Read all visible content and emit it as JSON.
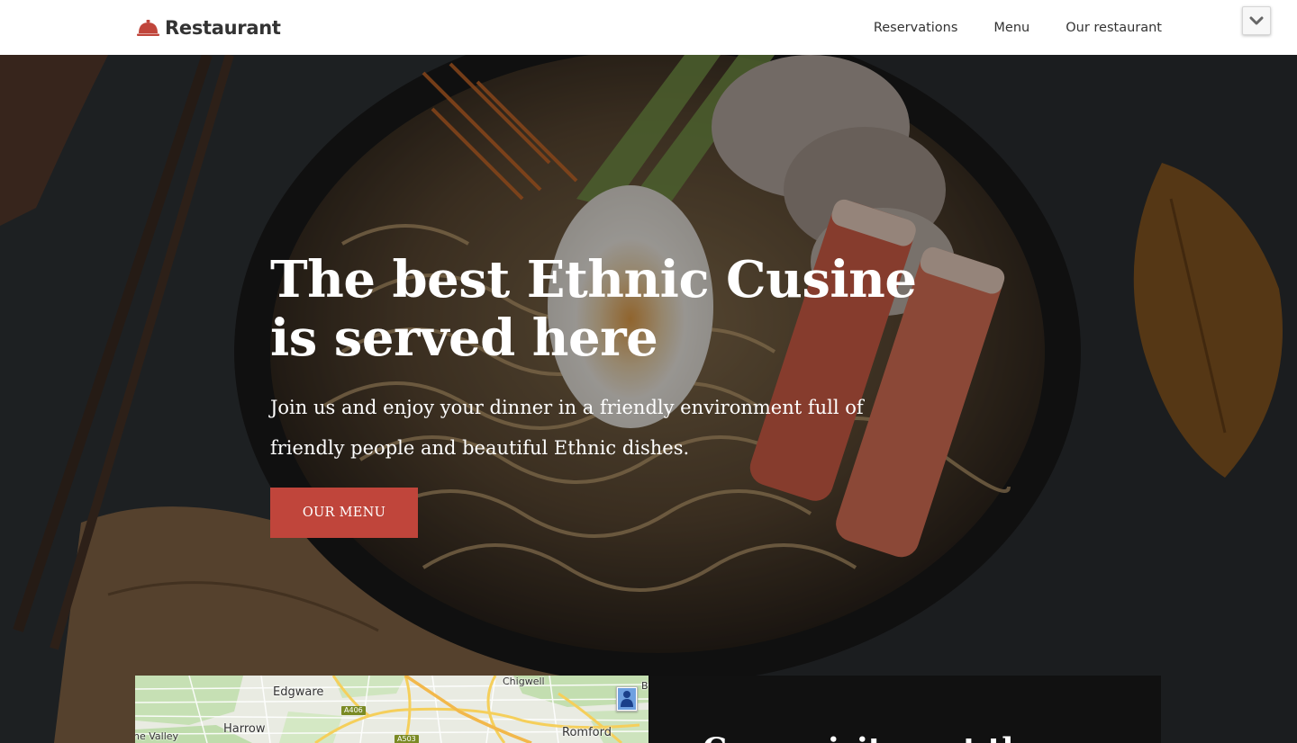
{
  "header": {
    "brand": "Restaurant",
    "brand_icon": "food-cloche-icon",
    "brand_color": "#c0453b",
    "nav": [
      "Reservations",
      "Menu",
      "Our restaurant"
    ],
    "toggle_icon": "chevron-down-icon"
  },
  "hero": {
    "title_line1": "The best Ethnic Cusine",
    "title_line2": "is served here",
    "subtitle": "Join us and enjoy your dinner in a friendly environment full of friendly people and beautiful Ethnic dishes.",
    "button_label": "OUR MENU",
    "button_color": "#c0453b"
  },
  "map": {
    "labels": {
      "edgware": "Edgware",
      "chigwell": "Chigwell",
      "harrow": "Harrow",
      "romford": "Romford",
      "valley": "ne Valley",
      "edge_b": "B"
    },
    "roads": {
      "a406": "A406",
      "a503": "A503"
    },
    "pegman_icon": "street-view-pegman-icon"
  },
  "info": {
    "heading": "Come visit us at the"
  }
}
